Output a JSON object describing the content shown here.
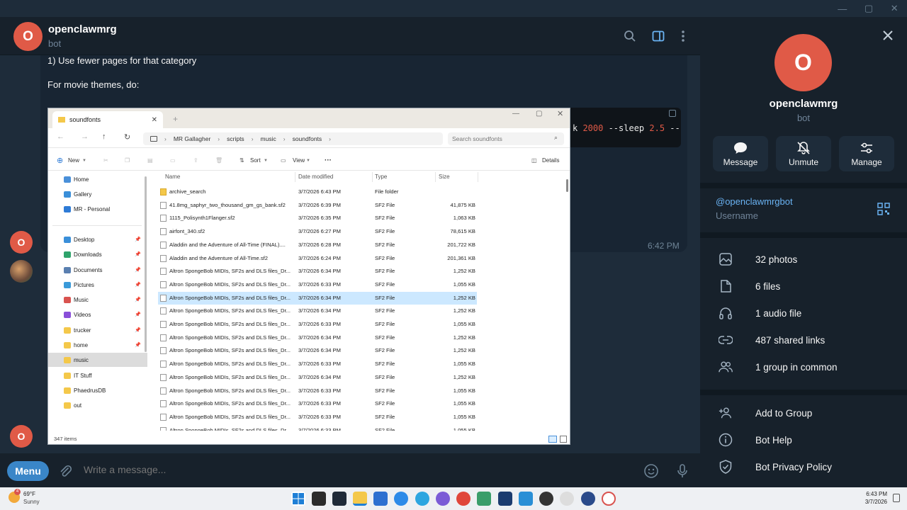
{
  "window": {
    "minimize": "—",
    "maximize": "▢",
    "close": "✕"
  },
  "chat": {
    "avatar_letter": "O",
    "name": "openclawmrg",
    "status": "bot",
    "msg_line1": "1) Use fewer pages for that category",
    "msg_line2": "For movie themes, do:",
    "code_prefix": "k ",
    "code_num1": "2000",
    "code_mid": " --sleep ",
    "code_num2": "2.5",
    "code_suffix": " --",
    "msg_time": "6:42 PM",
    "side_avatar1": "O",
    "side_avatar2": "O",
    "menu_label": "Menu",
    "input_placeholder": "Write a message..."
  },
  "explorer": {
    "tab_title": "soundfonts",
    "tab_add": "+",
    "path": [
      "MR Gallagher",
      "scripts",
      "music",
      "soundfonts"
    ],
    "search_placeholder": "Search soundfonts",
    "toolbar": {
      "new": "New",
      "sort": "Sort",
      "view": "View",
      "more": "···",
      "details": "Details"
    },
    "nav": [
      {
        "label": "Home",
        "color": "#4a90d9",
        "pin": ""
      },
      {
        "label": "Gallery",
        "color": "#3a8fd9",
        "pin": ""
      },
      {
        "label": "MR - Personal",
        "color": "#2e7bd6",
        "pin": ""
      },
      {
        "label": "Desktop",
        "color": "#3a8fd9",
        "pin": "📌"
      },
      {
        "label": "Downloads",
        "color": "#2fa36b",
        "pin": "📌"
      },
      {
        "label": "Documents",
        "color": "#5a7fb0",
        "pin": "📌"
      },
      {
        "label": "Pictures",
        "color": "#3a9ad9",
        "pin": "📌"
      },
      {
        "label": "Music",
        "color": "#d9534f",
        "pin": "📌"
      },
      {
        "label": "Videos",
        "color": "#8a4fd9",
        "pin": "📌"
      },
      {
        "label": "trucker",
        "color": "#f4c84a",
        "pin": "📌"
      },
      {
        "label": "home",
        "color": "#f4c84a",
        "pin": "📌"
      },
      {
        "label": "music",
        "color": "#f4c84a",
        "pin": ""
      },
      {
        "label": "IT Stuff",
        "color": "#f4c84a",
        "pin": ""
      },
      {
        "label": "PhaedrusDB",
        "color": "#f4c84a",
        "pin": ""
      },
      {
        "label": "out",
        "color": "#f4c84a",
        "pin": ""
      }
    ],
    "columns": {
      "name": "Name",
      "date": "Date modified",
      "type": "Type",
      "size": "Size"
    },
    "rows": [
      {
        "name": "archive_search",
        "date": "3/7/2026 6:43 PM",
        "type": "File folder",
        "size": ""
      },
      {
        "name": "41.8mg_saphyr_two_thousand_gm_gs_bank.sf2",
        "date": "3/7/2026 6:39 PM",
        "type": "SF2 File",
        "size": "41,875 KB"
      },
      {
        "name": "1115_Polisynth1Flanger.sf2",
        "date": "3/7/2026 6:35 PM",
        "type": "SF2 File",
        "size": "1,063 KB"
      },
      {
        "name": "airfont_340.sf2",
        "date": "3/7/2026 6:27 PM",
        "type": "SF2 File",
        "size": "78,615 KB"
      },
      {
        "name": "Aladdin and the Adventure of All-Time (FINAL)....",
        "date": "3/7/2026 6:28 PM",
        "type": "SF2 File",
        "size": "201,722 KB"
      },
      {
        "name": "Aladdin and the Adventure of All-Time.sf2",
        "date": "3/7/2026 6:24 PM",
        "type": "SF2 File",
        "size": "201,361 KB"
      },
      {
        "name": "Altron SpongeBob MIDIs, SF2s and DLS files_Dr...",
        "date": "3/7/2026 6:34 PM",
        "type": "SF2 File",
        "size": "1,252 KB"
      },
      {
        "name": "Altron SpongeBob MIDIs, SF2s and DLS files_Dr...",
        "date": "3/7/2026 6:33 PM",
        "type": "SF2 File",
        "size": "1,055 KB"
      },
      {
        "name": "Altron SpongeBob MIDIs, SF2s and DLS files_Dr...",
        "date": "3/7/2026 6:34 PM",
        "type": "SF2 File",
        "size": "1,252 KB"
      },
      {
        "name": "Altron SpongeBob MIDIs, SF2s and DLS files_Dr...",
        "date": "3/7/2026 6:34 PM",
        "type": "SF2 File",
        "size": "1,252 KB"
      },
      {
        "name": "Altron SpongeBob MIDIs, SF2s and DLS files_Dr...",
        "date": "3/7/2026 6:33 PM",
        "type": "SF2 File",
        "size": "1,055 KB"
      },
      {
        "name": "Altron SpongeBob MIDIs, SF2s and DLS files_Dr...",
        "date": "3/7/2026 6:34 PM",
        "type": "SF2 File",
        "size": "1,252 KB"
      },
      {
        "name": "Altron SpongeBob MIDIs, SF2s and DLS files_Dr...",
        "date": "3/7/2026 6:34 PM",
        "type": "SF2 File",
        "size": "1,252 KB"
      },
      {
        "name": "Altron SpongeBob MIDIs, SF2s and DLS files_Dr...",
        "date": "3/7/2026 6:33 PM",
        "type": "SF2 File",
        "size": "1,055 KB"
      },
      {
        "name": "Altron SpongeBob MIDIs, SF2s and DLS files_Dr...",
        "date": "3/7/2026 6:34 PM",
        "type": "SF2 File",
        "size": "1,252 KB"
      },
      {
        "name": "Altron SpongeBob MIDIs, SF2s and DLS files_Dr...",
        "date": "3/7/2026 6:33 PM",
        "type": "SF2 File",
        "size": "1,055 KB"
      },
      {
        "name": "Altron SpongeBob MIDIs, SF2s and DLS files_Dr...",
        "date": "3/7/2026 6:33 PM",
        "type": "SF2 File",
        "size": "1,055 KB"
      },
      {
        "name": "Altron SpongeBob MIDIs, SF2s and DLS files_Dr...",
        "date": "3/7/2026 6:33 PM",
        "type": "SF2 File",
        "size": "1,055 KB"
      },
      {
        "name": "Altron SpongeBob MIDIs, SF2s and DLS files_Dr...",
        "date": "3/7/2026 6:33 PM",
        "type": "SF2 File",
        "size": "1,055 KB"
      }
    ],
    "status": "347 items"
  },
  "panel": {
    "avatar_letter": "O",
    "name": "openclawmrg",
    "status": "bot",
    "actions": [
      "Message",
      "Unmute",
      "Manage"
    ],
    "username": "@openclawmrgbot",
    "username_label": "Username",
    "media": [
      "32 photos",
      "6 files",
      "1 audio file",
      "487 shared links",
      "1 group in common"
    ],
    "bot_actions": [
      "Add to Group",
      "Bot Help",
      "Bot Privacy Policy"
    ]
  },
  "taskbar": {
    "weather_temp": "69°F",
    "weather_desc": "Sunny",
    "weather_badge": "4",
    "time": "6:43 PM",
    "date": "3/7/2026"
  },
  "colors": {
    "accent": "#3a86c8",
    "avatar": "#e05a47",
    "link": "#6ab3f3"
  }
}
